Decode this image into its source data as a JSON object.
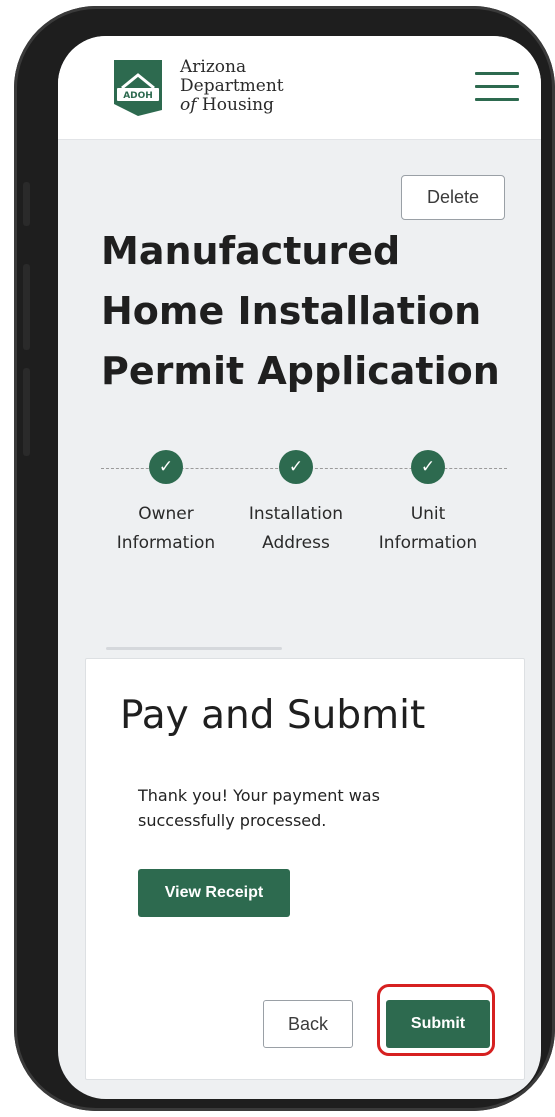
{
  "brand": {
    "logo_badge": "ADOH",
    "name_line1": "Arizona",
    "name_line2": "Department",
    "name_line3_italic": "of",
    "name_line3_rest": " Housing",
    "accent_color": "#2d6a4f"
  },
  "header": {
    "menu_icon": "hamburger-menu-icon"
  },
  "page": {
    "delete_label": "Delete",
    "title": "Manufactured Home Installation Permit Application"
  },
  "stepper": {
    "steps": [
      {
        "label": "Owner\nInformation",
        "status": "complete",
        "icon": "check-icon"
      },
      {
        "label": "Installation\nAddress",
        "status": "complete",
        "icon": "check-icon"
      },
      {
        "label": "Unit\nInformation",
        "status": "complete",
        "icon": "check-icon"
      }
    ]
  },
  "card": {
    "title": "Pay and Submit",
    "message": "Thank you! Your payment was successfully processed.",
    "view_receipt_label": "View Receipt",
    "back_label": "Back",
    "submit_label": "Submit",
    "highlight_color": "#d62020"
  }
}
